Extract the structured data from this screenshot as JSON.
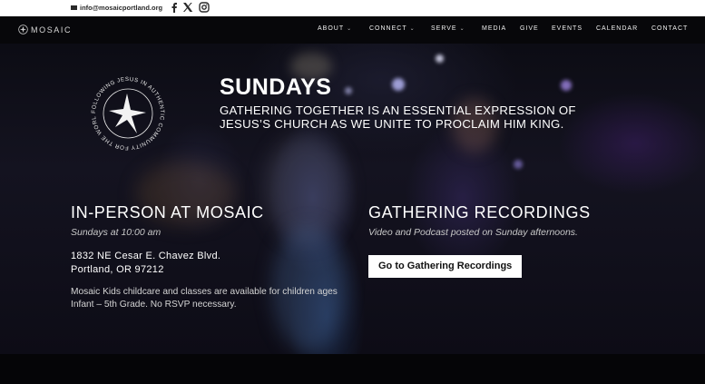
{
  "topbar": {
    "email": "info@mosaicportland.org",
    "icons": [
      "mail-icon",
      "facebook-icon",
      "x-icon",
      "instagram-icon"
    ]
  },
  "header": {
    "logo_text": "MOSAIC",
    "nav": [
      {
        "label": "ABOUT",
        "has_dropdown": true
      },
      {
        "label": "CONNECT",
        "has_dropdown": true
      },
      {
        "label": "SERVE",
        "has_dropdown": true
      },
      {
        "label": "MEDIA",
        "has_dropdown": false
      },
      {
        "label": "GIVE",
        "has_dropdown": false
      },
      {
        "label": "EVENTS",
        "has_dropdown": false
      },
      {
        "label": "CALENDAR",
        "has_dropdown": false
      },
      {
        "label": "CONTACT",
        "has_dropdown": false
      }
    ]
  },
  "hero": {
    "emblem_text": "FOLLOWING JESUS IN AUTHENTIC COMMUNITY FOR THE WORLD",
    "title": "SUNDAYS",
    "subtitle": "GATHERING TOGETHER IS AN ESSENTIAL EXPRESSION OF JESUS’S CHURCH AS WE UNITE TO PROCLAIM HIM KING."
  },
  "in_person": {
    "title": "IN-PERSON AT MOSAIC",
    "time": "Sundays at 10:00 am",
    "address_line1": "1832 NE Cesar E. Chavez Blvd.",
    "address_line2": "Portland, OR 97212",
    "kids_note": "Mosaic Kids childcare and classes are available for children ages Infant – 5th Grade. No RSVP necessary."
  },
  "recordings": {
    "title": "GATHERING RECORDINGS",
    "note": "Video and Podcast posted on Sunday afternoons.",
    "button_label": "Go to Gathering Recordings"
  },
  "colors": {
    "topbar_bg": "#ffffff",
    "header_bg": "#07070a",
    "button_bg": "#ffffff",
    "text": "#ffffff"
  }
}
